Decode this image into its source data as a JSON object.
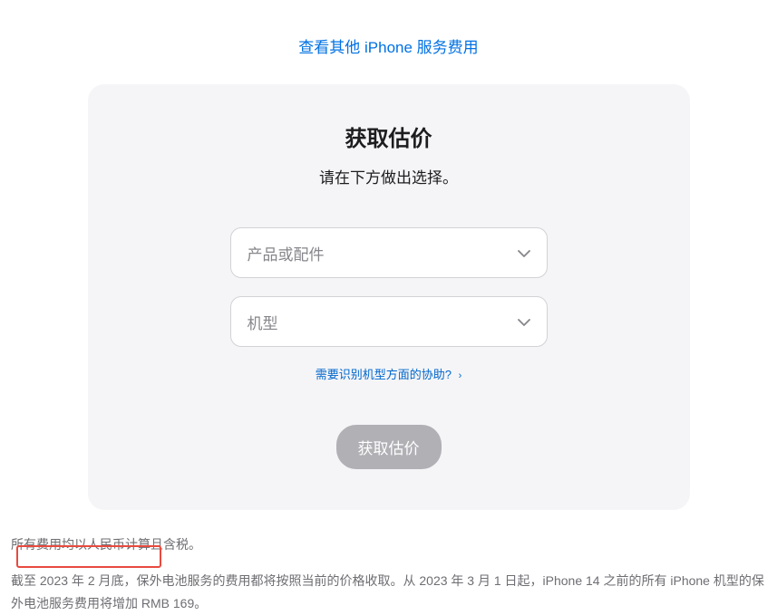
{
  "topLink": {
    "text": "查看其他 iPhone 服务费用"
  },
  "card": {
    "title": "获取估价",
    "subtitle": "请在下方做出选择。",
    "select1": {
      "placeholder": "产品或配件"
    },
    "select2": {
      "placeholder": "机型"
    },
    "helpLink": {
      "text": "需要识别机型方面的协助?",
      "arrow": "›"
    },
    "button": {
      "label": "获取估价"
    }
  },
  "footer": {
    "line1": "所有费用均以人民币计算且含税。",
    "line2": "截至 2023 年 2 月底，保外电池服务的费用都将按照当前的价格收取。从 2023 年 3 月 1 日起，iPhone 14 之前的所有 iPhone 机型的保外电池服务费用将增加 RMB 169。"
  }
}
